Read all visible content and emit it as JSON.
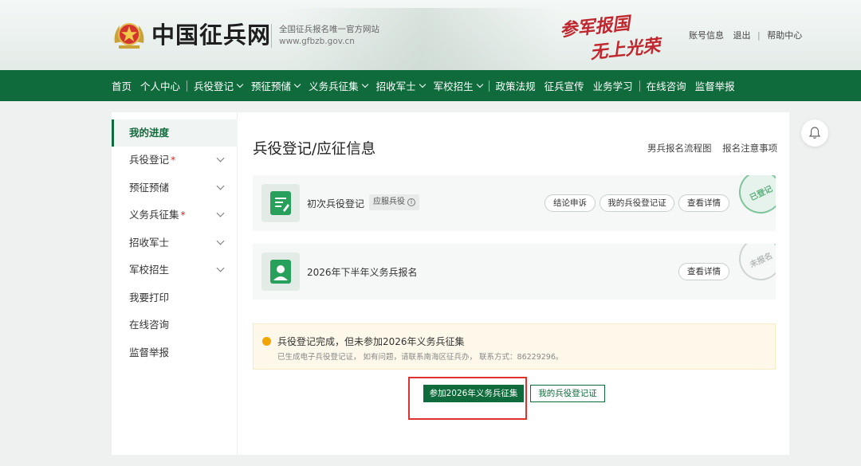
{
  "header": {
    "site_name": "中国征兵网",
    "tagline": "全国征兵报名唯一官方网站",
    "domain": "www.gfbzb.gov.cn",
    "slogan_line1": "参军报国",
    "slogan_line2": "无上光荣",
    "account_link": "账号信息",
    "logout_link": "退出",
    "help_link": "帮助中心"
  },
  "nav": {
    "items": [
      {
        "label": "首页"
      },
      {
        "label": "个人中心"
      },
      {
        "label": "兵役登记"
      },
      {
        "label": "预征预储"
      },
      {
        "label": "义务兵征集"
      },
      {
        "label": "招收军士"
      },
      {
        "label": "军校招生"
      },
      {
        "label": "政策法规"
      },
      {
        "label": "征兵宣传"
      },
      {
        "label": "业务学习"
      },
      {
        "label": "在线咨询"
      },
      {
        "label": "监督举报"
      }
    ]
  },
  "sidebar": {
    "items": [
      {
        "label": "我的进度"
      },
      {
        "label": "兵役登记",
        "star": "*"
      },
      {
        "label": "预征预储"
      },
      {
        "label": "义务兵征集",
        "star": "*"
      },
      {
        "label": "招收军士"
      },
      {
        "label": "军校招生"
      },
      {
        "label": "我要打印"
      },
      {
        "label": "在线咨询"
      },
      {
        "label": "监督举报"
      }
    ]
  },
  "main": {
    "title": "兵役登记/应征信息",
    "link_flow": "男兵报名流程图",
    "link_notes": "报名注意事项",
    "cards": [
      {
        "name": "初次兵役登记",
        "badge": "应服兵役",
        "buttons": [
          "结论申诉",
          "我的兵役登记证",
          "查看详情"
        ],
        "stamp": "已登记"
      },
      {
        "name": "2026年下半年义务兵报名",
        "buttons": [
          "查看详情"
        ],
        "stamp": "未报名"
      }
    ],
    "notice": {
      "message": "兵役登记完成，但未参加2026年义务兵征集",
      "detail": "已生成电子兵役登记证， 如有问题，请联系南海区征兵办， 联系方式：86229296。"
    },
    "join_button": "参加2026年义务兵征集",
    "cert_button": "我的兵役登记证"
  },
  "colors": {
    "brand_green": "#0f6b3c",
    "notice_dot": "#f0a500",
    "highlight_red": "#e0322e"
  }
}
